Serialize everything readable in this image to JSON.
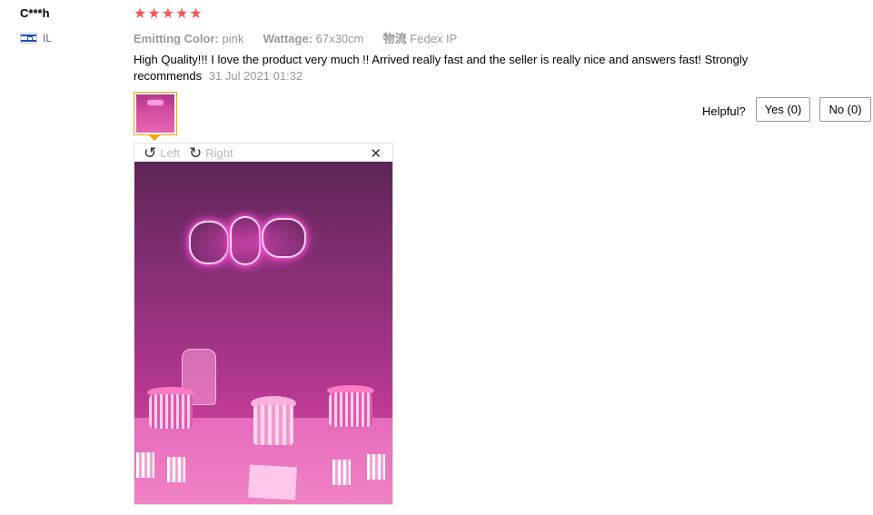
{
  "user": {
    "name": "C***h",
    "country": "IL",
    "flag_icon": "israel-flag-icon"
  },
  "rating": {
    "stars": 5,
    "max": 5,
    "color": "#f2565a"
  },
  "attributes": [
    {
      "label": "Emitting Color:",
      "value": "pink"
    },
    {
      "label": "Wattage:",
      "value": "67x30cm"
    },
    {
      "label": "物流",
      "value": "Fedex IP"
    }
  ],
  "review": {
    "text": "High Quality!!! I love the product very much !! Arrived really fast and the seller is really nice and answers fast! Strongly recommends",
    "date": "31 Jul 2021 01:32"
  },
  "viewer": {
    "rotate_left_label": "Left",
    "rotate_right_label": "Right",
    "close_icon": "close-icon"
  },
  "helpful": {
    "label": "Helpful?",
    "yes_label": "Yes (0)",
    "no_label": "No (0)"
  },
  "colors": {
    "thumb_border": "#f0a500",
    "muted_text": "#999999"
  }
}
